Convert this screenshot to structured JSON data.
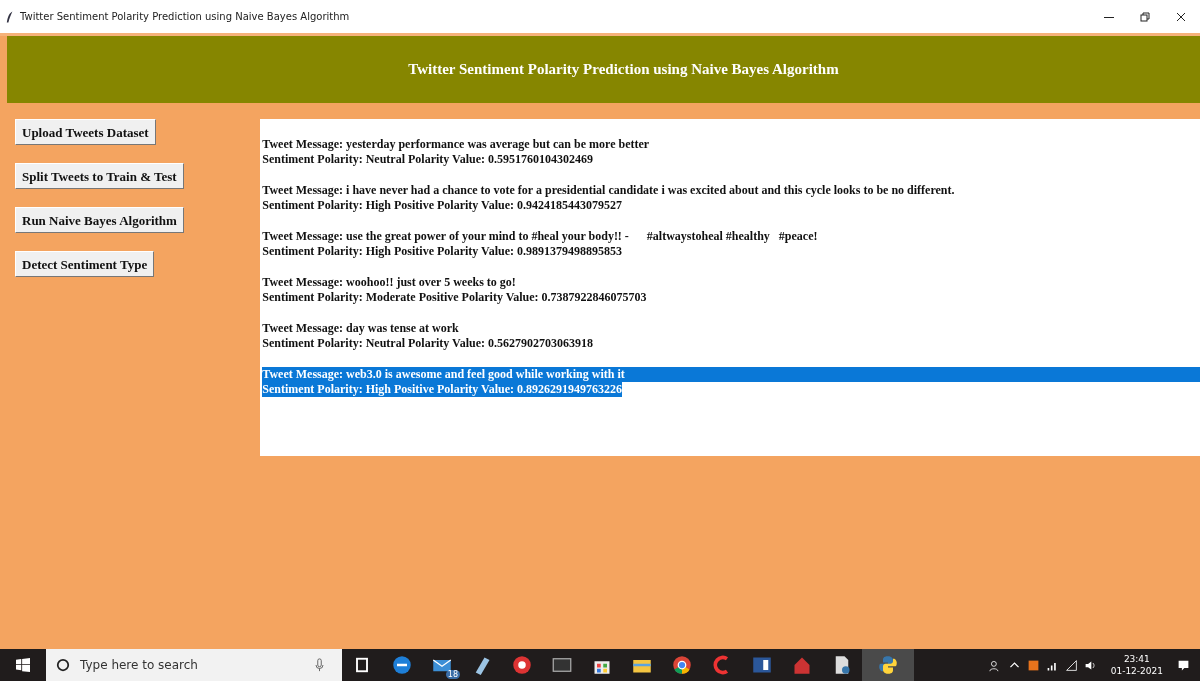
{
  "window": {
    "title": "Twitter Sentiment Polarity Prediction using Naive Bayes Algorithm"
  },
  "header": {
    "title": "Twitter Sentiment Polarity Prediction using Naive Bayes Algorithm"
  },
  "buttons": [
    "Upload Tweets Dataset",
    "Split Tweets to Train & Test",
    "Run Naive Bayes Algorithm",
    "Detect Sentiment Type"
  ],
  "output": [
    {
      "message": "Tweet Message: yesterday performance was average but can be more better",
      "polarity": "Sentiment Polarity: Neutral Polarity Value: 0.5951760104302469",
      "selected": false
    },
    {
      "message": "Tweet Message: i have never had a chance to vote for a presidential candidate i was excited about and this cycle looks to be no different.",
      "polarity": "Sentiment Polarity: High Positive Polarity Value: 0.9424185443079527",
      "selected": false
    },
    {
      "message": "Tweet Message: use the great power of your mind to #heal your body!! -      #altwaystoheal #healthy   #peace!",
      "polarity": "Sentiment Polarity: High Positive Polarity Value: 0.9891379498895853",
      "selected": false
    },
    {
      "message": "Tweet Message: woohoo!! just over 5 weeks to go!",
      "polarity": "Sentiment Polarity: Moderate Positive Polarity Value: 0.7387922846075703",
      "selected": false
    },
    {
      "message": "Tweet Message: day was tense at work",
      "polarity": "Sentiment Polarity: Neutral Polarity Value: 0.5627902703063918",
      "selected": false
    },
    {
      "message": "Tweet Message: web3.0 is awesome and feel good while working with it",
      "polarity": "Sentiment Polarity: High Positive Polarity Value: 0.8926291949763226",
      "selected": true
    }
  ],
  "taskbar": {
    "search": {
      "placeholder": "Type here to search"
    },
    "mail_badge": "18",
    "time": "23:41",
    "date": "01-12-2021"
  }
}
